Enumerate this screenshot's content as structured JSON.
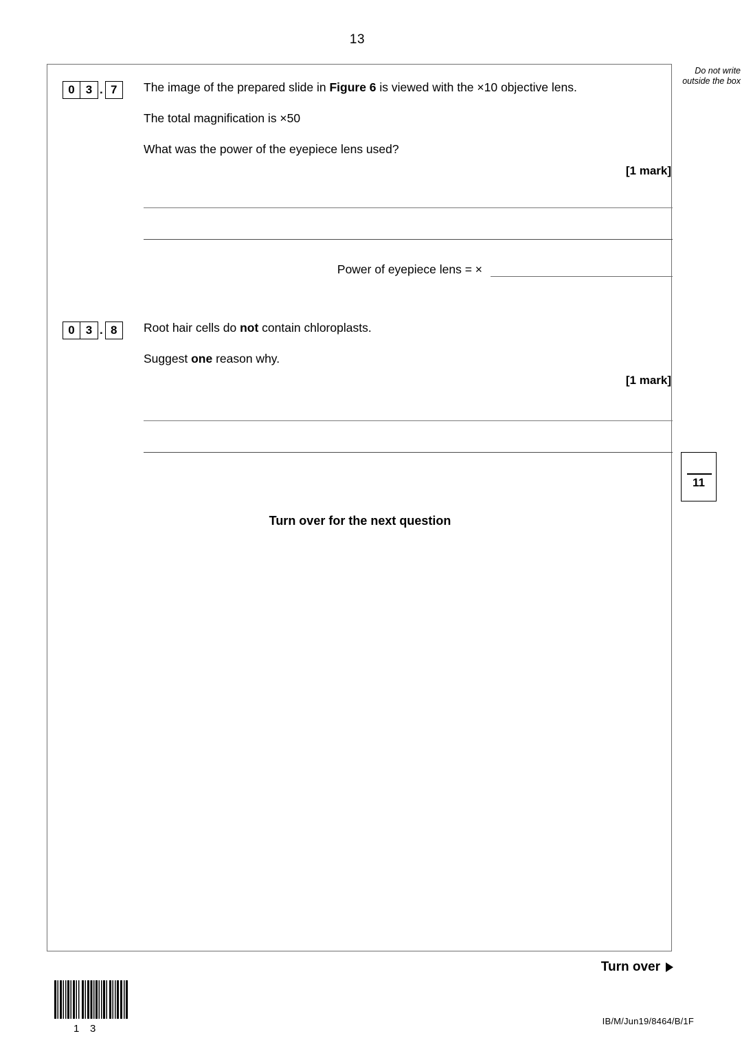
{
  "page": {
    "page_number": "13",
    "margin_note": "Do not write\noutside the\nbox",
    "turn_over_label": "Turn over",
    "turn_over_icon": "triangle-right-icon",
    "paper_code": "IB/M/Jun19/8464/B/1F",
    "barcode": {
      "icon": "barcode-icon",
      "digit_left": "1",
      "digit_right": "3"
    }
  },
  "questions": [
    {
      "id": "03.7",
      "number_cells": [
        "0",
        "3",
        "7"
      ],
      "number_separator": ".",
      "lines": [
        {
          "prefix": "The image of the prepared slide in ",
          "bold": "Figure 6",
          "suffix": " is viewed with the ×10 objective lens."
        },
        {
          "prefix": "The total magnification is ×50",
          "bold": "",
          "suffix": ""
        },
        {
          "prefix": "What was the power of the eyepiece lens used?",
          "bold": "",
          "suffix": ""
        }
      ],
      "marks": "[1 mark]",
      "answer_lines": 2,
      "answer_field": {
        "label": "Power of eyepiece lens = ×",
        "value": ""
      }
    },
    {
      "id": "03.8",
      "number_cells": [
        "0",
        "3",
        "8"
      ],
      "number_separator": ".",
      "lines": [
        {
          "prefix": "Root hair cells do ",
          "bold": "not",
          "suffix": " contain chloroplasts."
        },
        {
          "prefix": "Suggest ",
          "bold": "one",
          "suffix": " reason why."
        }
      ],
      "marks": "[1 mark]",
      "answer_lines": 2,
      "answer_field": null
    }
  ],
  "turn_next_question": "Turn over for the next question",
  "total_marks_box": {
    "value": "11"
  }
}
